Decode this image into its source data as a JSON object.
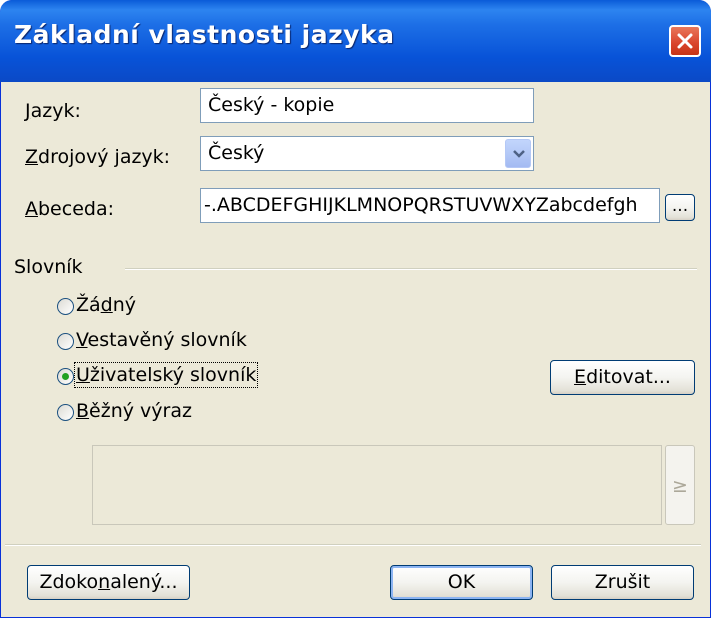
{
  "window": {
    "title": "Základní vlastnosti jazyka"
  },
  "fields": {
    "jazyk": {
      "label_prefix": "",
      "label_accel": "J",
      "label_rest": "azyk:",
      "value": "Český - kopie"
    },
    "zdrojovy": {
      "label_accel": "Z",
      "label_rest": "drojový jazyk:",
      "value": "Český"
    },
    "abeceda": {
      "label_accel": "A",
      "label_rest": "beceda:",
      "value": "-.ABCDEFGHIJKLMNOPQRSTUVWXYZabcdefgh",
      "browse_label": "..."
    }
  },
  "dictionary": {
    "group_label": "Slovník",
    "options": [
      {
        "pre": "Žá",
        "accel": "d",
        "post": "ný",
        "checked": false
      },
      {
        "pre": "",
        "accel": "V",
        "post": "estavěný slovník",
        "checked": false
      },
      {
        "pre": "",
        "accel": "U",
        "post": "živatelský slovník",
        "checked": true
      },
      {
        "pre": "",
        "accel": "B",
        "post": "ěžný výraz",
        "checked": false
      }
    ],
    "edit_button": {
      "accel": "E",
      "rest": "ditovat..."
    },
    "insert_button_label": "≥"
  },
  "buttons": {
    "advanced": {
      "pre": "Zdoko",
      "accel": "n",
      "post": "alený..."
    },
    "ok": "OK",
    "cancel": "Zrušit"
  }
}
